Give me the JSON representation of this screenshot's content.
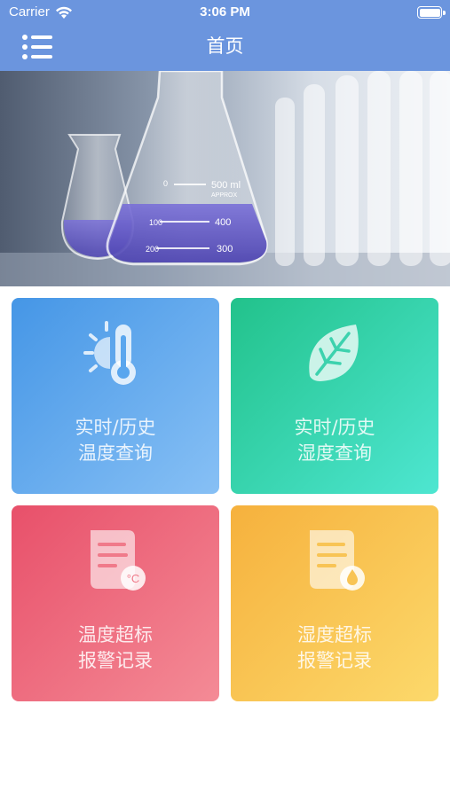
{
  "status_bar": {
    "carrier": "Carrier",
    "time": "3:06 PM"
  },
  "nav": {
    "title": "首页",
    "menu_icon": "list-menu-icon"
  },
  "banner": {
    "image": "laboratory-glassware-photo",
    "labels": [
      "500 ml",
      "APPROX",
      "400",
      "300",
      "100",
      "200",
      "0"
    ]
  },
  "tiles": [
    {
      "line1": "实时/历史",
      "line2": "温度查询",
      "icon": "thermometer-sun-icon",
      "color": "#4596e6"
    },
    {
      "line1": "实时/历史",
      "line2": "湿度查询",
      "icon": "leaf-icon",
      "color": "#22c28b"
    },
    {
      "line1": "温度超标",
      "line2": "报警记录",
      "icon": "document-temperature-icon",
      "color": "#e8506a"
    },
    {
      "line1": "湿度超标",
      "line2": "报警记录",
      "icon": "document-humidity-icon",
      "color": "#f6b13d"
    }
  ],
  "temp_unit_badge": "°C"
}
